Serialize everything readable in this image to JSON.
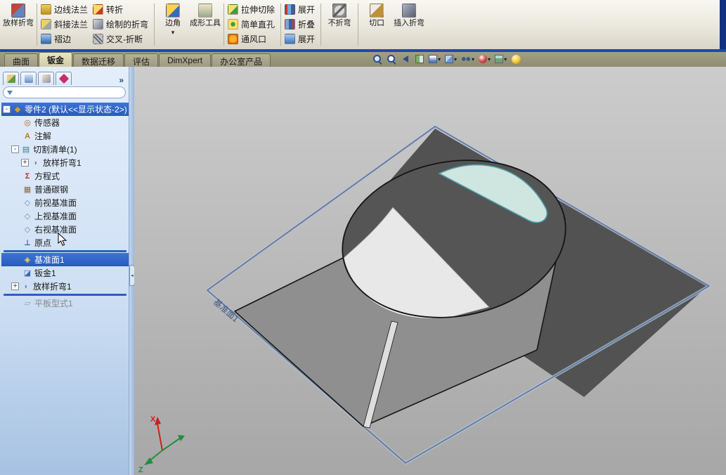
{
  "colors": {
    "selection_blue": "#2f63c4",
    "tabbar_olive": "#93907a",
    "active_tab": "#d6d2ae",
    "viewport_gray": "#c2c2c2",
    "plate_edge_blue": "#64789f",
    "highlight_cyan": "#4f9fa8",
    "toolbar_bottom_strip": "#2148a8"
  },
  "toolbar": {
    "lofted_bend": "放样折弯",
    "edge_flange": "边线法兰",
    "miter_flange": "斜接法兰",
    "hem": "褶边",
    "jog": "转折",
    "sketched_bend": "绘制的折弯",
    "cross_break": "交叉-折断",
    "corner": "边角",
    "forming_tool": "成形工具",
    "extruded_cut": "拉伸切除",
    "simple_hole": "简单直孔",
    "vent": "通风口",
    "unfold": "展开",
    "fold": "折叠",
    "flatten": "展开",
    "no_bends": "不折弯",
    "rip": "切口",
    "insert_bends": "插入折弯"
  },
  "ribbon_tabs": {
    "surface": "曲面",
    "sheet_metal": "钣金",
    "data_migration": "数据迁移",
    "evaluate": "评估",
    "dimxpert": "DimXpert",
    "office": "办公室产品"
  },
  "panel": {
    "overflow_chevron": "»",
    "filter_value": ""
  },
  "tree": {
    "root": "零件2 (默认<<显示状态-2>)",
    "sensors": "传感器",
    "annotations": "注解",
    "cut_list": "切割清单(1)",
    "cut_list_item": "放样折弯1",
    "equations": "方程式",
    "material": "普通碳钢",
    "front_plane": "前视基准面",
    "top_plane": "上视基准面",
    "right_plane": "右视基准面",
    "origin": "原点",
    "plane1": "基准面1",
    "sheet_metal1": "钣金1",
    "lofted_bend1": "放样折弯1",
    "flat_pattern1": "平板型式1"
  },
  "icons": {
    "sensor": "◎",
    "annotation": "A",
    "cutlist": "▤",
    "equation": "Σ",
    "material": "▦",
    "plane": "◇",
    "origin": "⊥",
    "part": "◆",
    "plane_sel": "◈",
    "sheet_metal": "◪",
    "lofted": "◗",
    "flat_pattern": "▱",
    "expand_plus": "+",
    "expand_minus": "-",
    "caret": "▾",
    "collapse": "◂"
  },
  "viewport": {
    "plane_label": "基准面1",
    "triad_x": "X",
    "triad_z": "Z"
  }
}
